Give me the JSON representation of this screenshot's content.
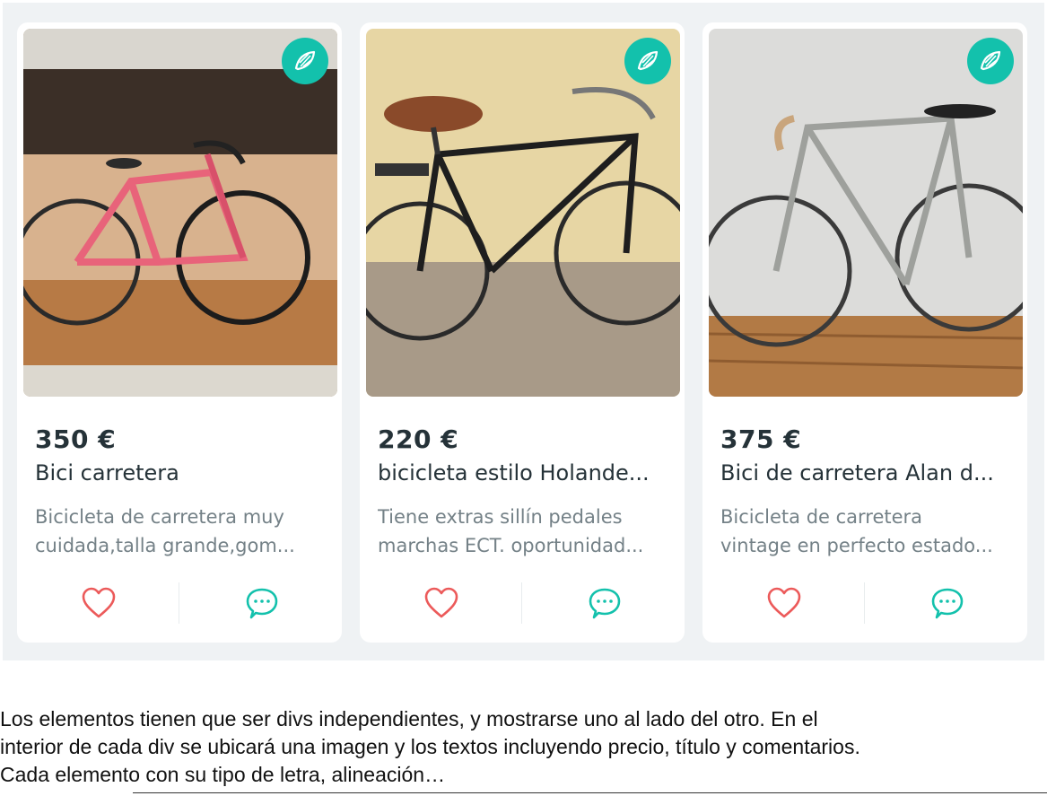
{
  "colors": {
    "page_bg": "#eff2f4",
    "card_bg": "#ffffff",
    "brand": "#13c1ac",
    "price": "#253238",
    "description": "#748187",
    "heart": "#ec5a5a"
  },
  "cards": [
    {
      "price": "350 €",
      "title": "Bici carretera",
      "description_line1": "Bicicleta de carretera muy",
      "description_line2": "cuidada,talla grande,gom...",
      "image_icon": "photo-road-bike-pink",
      "badge_icon": "wing-icon",
      "favorite_icon": "heart-icon",
      "chat_icon": "chat-bubble-icon"
    },
    {
      "price": "220 €",
      "title": "bicicleta estilo Holande...",
      "description_line1": "Tiene extras sillín pedales",
      "description_line2": "marchas ECT. oportunidad...",
      "image_icon": "photo-dutch-bike-black",
      "badge_icon": "wing-icon",
      "favorite_icon": "heart-icon",
      "chat_icon": "chat-bubble-icon"
    },
    {
      "price": "375 €",
      "title": "Bici de carretera Alan d...",
      "description_line1": "Bicicleta de carretera",
      "description_line2": "vintage en perfecto estado...",
      "image_icon": "photo-vintage-bike-silver",
      "badge_icon": "wing-icon",
      "favorite_icon": "heart-icon",
      "chat_icon": "chat-bubble-icon"
    }
  ],
  "instructions": {
    "line1": "Los elementos tienen que ser divs independientes, y mostrarse uno al lado del otro. En el",
    "line2": "interior de cada div se ubicará una imagen y los textos incluyendo precio, título y comentarios.",
    "line3": "Cada elemento con su tipo de letra, alineación…"
  }
}
